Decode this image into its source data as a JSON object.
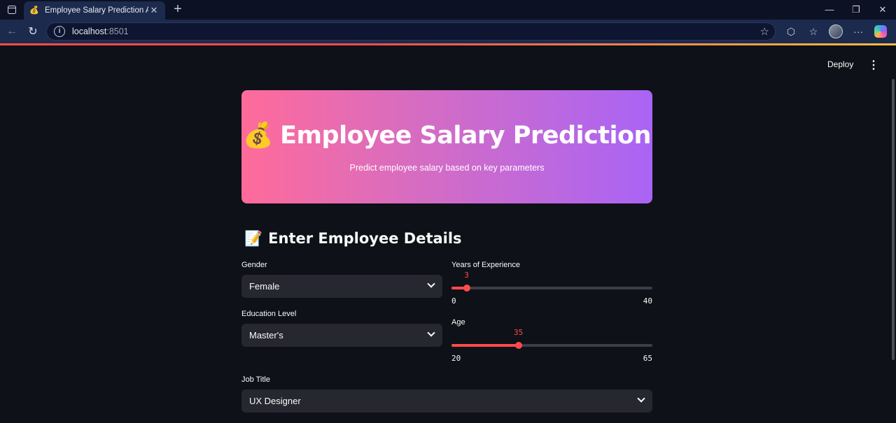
{
  "browser": {
    "tab_title": "Employee Salary Prediction App",
    "tab_icon": "money-bag-icon",
    "url_host": "localhost",
    "url_port": ":8501"
  },
  "app": {
    "deploy_label": "Deploy",
    "hero": {
      "emoji": "💰",
      "title": "Employee Salary Prediction",
      "subtitle": "Predict employee salary based on key parameters"
    },
    "section": {
      "emoji": "📝",
      "title": "Enter Employee Details"
    },
    "fields": {
      "gender": {
        "label": "Gender",
        "value": "Female"
      },
      "education": {
        "label": "Education Level",
        "value": "Master's"
      },
      "job_title": {
        "label": "Job Title",
        "value": "UX Designer"
      },
      "experience": {
        "label": "Years of Experience",
        "value": 3,
        "min": 0,
        "max": 40
      },
      "age": {
        "label": "Age",
        "value": 35,
        "min": 20,
        "max": 65
      }
    }
  },
  "colors": {
    "accent": "#ff4b4b",
    "hero_gradient_start": "#ff6b9a",
    "hero_gradient_end": "#a964f5",
    "background": "#0e1117",
    "input_bg": "#262730"
  }
}
